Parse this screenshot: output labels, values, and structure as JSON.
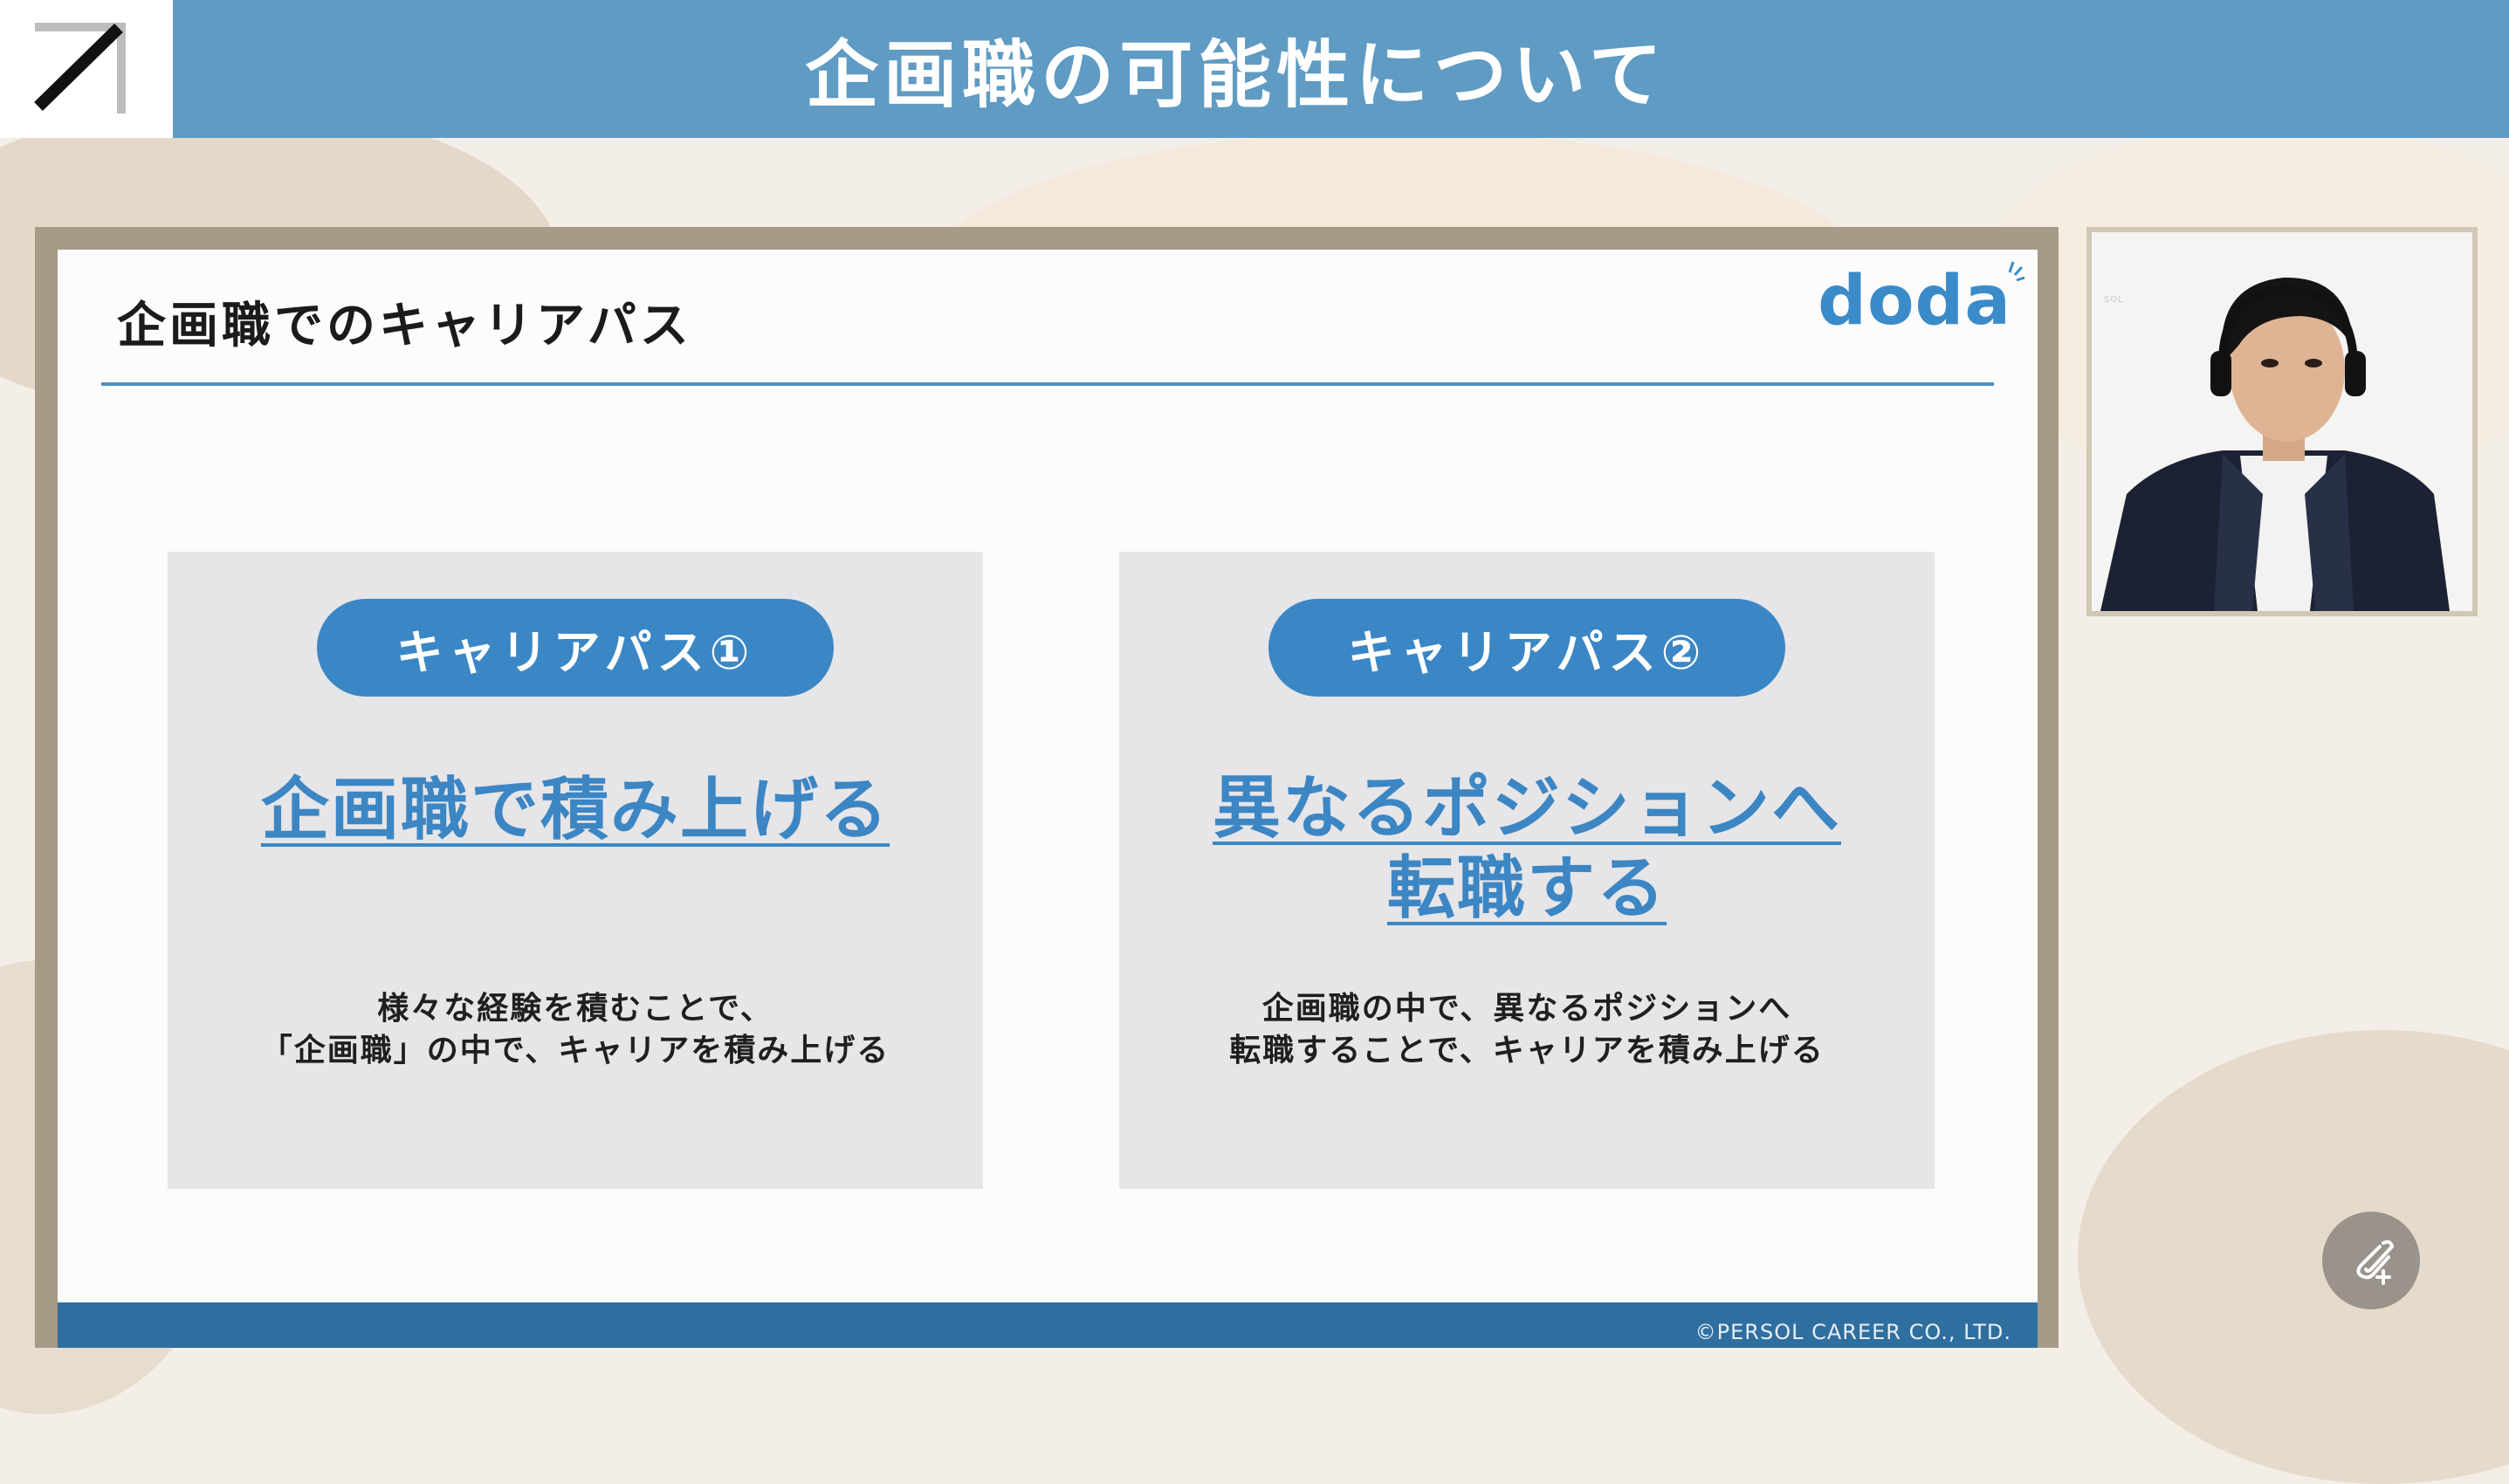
{
  "header": {
    "title": "企画職の可能性について"
  },
  "logo": {
    "icon": "slash-corner-logo-icon"
  },
  "slide": {
    "title": "企画職でのキャリアパス",
    "brand": "doda",
    "cards": [
      {
        "pill": "キャリアパス①",
        "headline": "企画職で積み上げる",
        "desc_line1": "様々な経験を積むことで、",
        "desc_line2": "「企画職」の中で、キャリアを積み上げる"
      },
      {
        "pill": "キャリアパス②",
        "headline_line1": "異なるポジションへ",
        "headline_line2": "転職する",
        "desc_line1": "企画職の中で、異なるポジションへ",
        "desc_line2": "転職することで、キャリアを積み上げる"
      }
    ],
    "copyright": "©PERSOL CAREER CO., LTD."
  },
  "video": {
    "watermark": "SOL"
  },
  "fab": {
    "icon": "paperclip-add-icon"
  },
  "colors": {
    "header": "#5f9bc3",
    "accent": "#3b87c6",
    "footer": "#2f6f9f"
  }
}
